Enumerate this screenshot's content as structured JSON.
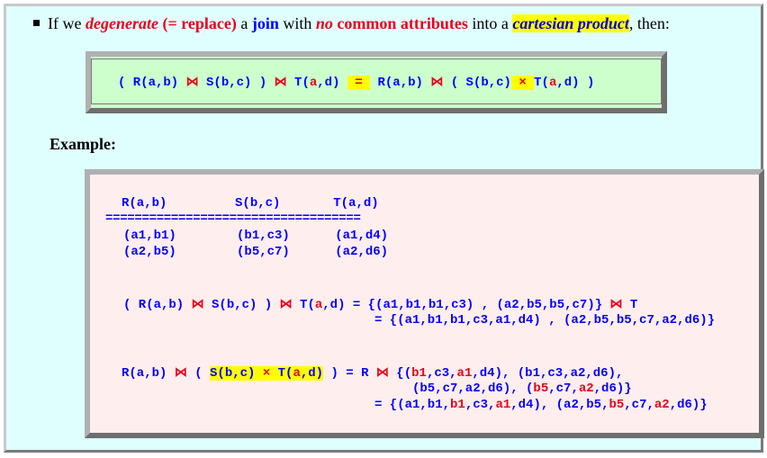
{
  "intro": {
    "t1": "If we ",
    "degenerate": "degenerate",
    "replace": " (= replace)",
    "t2": " a ",
    "join": "join",
    "t3": " with ",
    "no": "no",
    "common": " common attributes",
    "t4": " into a ",
    "cartesian": "cartesian product",
    "t5": ", then:"
  },
  "rule": {
    "p1": "( R(a,b) ",
    "j1": "⋈",
    "p2": " S(b,c) ) ",
    "j2": "⋈",
    "p3": " T(",
    "a1": "a",
    "p4": ",d) ",
    "eq": " = ",
    "p5": " R(a,b) ",
    "j3": "⋈",
    "p6": " ( S(b,c)",
    "x": " × ",
    "p7": "T(",
    "a2": "a",
    "p8": ",d) )"
  },
  "example_label": "Example:",
  "example": {
    "header": "R(a,b)         S(b,c)       T(a,d)",
    "rule_line": "===================================",
    "row1": "(a1,b1)        (b1,c3)      (a1,d4)",
    "row2": "(a2,b5)        (b5,c7)      (a2,d6)",
    "l1_a": "( R(a,b) ",
    "l1_j1": "⋈",
    "l1_b": " S(b,c) ) ",
    "l1_j2": "⋈",
    "l1_c": " T(",
    "l1_a_red": "a",
    "l1_d": ",d) = {(a1,b1,b1,c3) , (a2,b5,b5,c7)} ",
    "l1_j3": "⋈",
    "l1_e": " T",
    "l2": "= {(a1,b1,b1,c3,a1,d4) , (a2,b5,b5,c7,a2,d6)}",
    "l3_a": "R(a,b) ",
    "l3_j1": "⋈",
    "l3_b": " ( ",
    "l3_hl1": "S(b,c) ",
    "l3_x": "×",
    "l3_hl2": " T(",
    "l3_ared": "a",
    "l3_hl3": ",d)",
    "l3_c": " ) = R ",
    "l3_j2": "⋈",
    "l3_d": " {(",
    "l3_b1": "b1",
    "l3_e": ",c3,",
    "l3_a1": "a1",
    "l3_f": ",d4), (b1,c3,a2,d6),",
    "l4_a": "(b5,c7,a2,d6), (",
    "l4_b5": "b5",
    "l4_b": ",c7,",
    "l4_a2": "a2",
    "l4_c": ",d6)}",
    "l5_a": "= {(a1,b1,",
    "l5_b1": "b1",
    "l5_b": ",c3,",
    "l5_a1": "a1",
    "l5_c": ",d4), (a2,b5,",
    "l5_b5": "b5",
    "l5_d": ",c7,",
    "l5_a2": "a2",
    "l5_e": ",d6)}"
  }
}
